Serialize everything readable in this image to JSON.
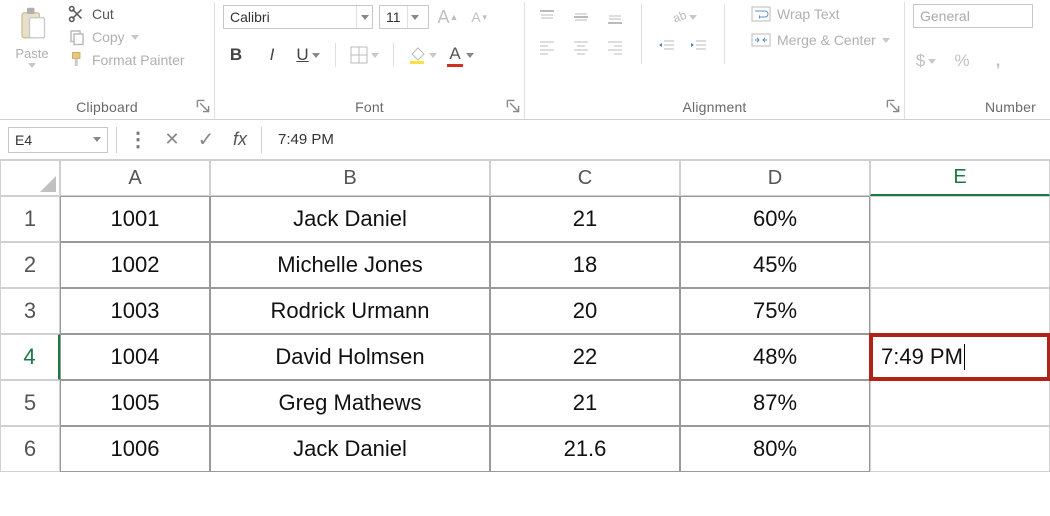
{
  "ribbon": {
    "clipboard": {
      "paste": "Paste",
      "cut": "Cut",
      "copy": "Copy",
      "format_painter": "Format Painter",
      "label": "Clipboard"
    },
    "font": {
      "family": "Calibri",
      "size": "11",
      "bold_glyph": "B",
      "italic_glyph": "I",
      "underline_glyph": "U",
      "increase_a": "A",
      "decrease_a": "A",
      "fontcolor_glyph": "A",
      "label": "Font"
    },
    "alignment": {
      "wrap_text": "Wrap Text",
      "merge_center": "Merge & Center",
      "label": "Alignment"
    },
    "number": {
      "format_value": "General",
      "currency_glyph": "$",
      "percent_glyph": "%",
      "comma_glyph": ",",
      "label": "Number"
    }
  },
  "formula_bar": {
    "name_box": "E4",
    "cancel_glyph": "✕",
    "enter_glyph": "✓",
    "fx_glyph": "fx",
    "value": "7:49 PM"
  },
  "grid": {
    "col_headers": [
      "A",
      "B",
      "C",
      "D",
      "E"
    ],
    "row_headers": [
      "1",
      "2",
      "3",
      "4",
      "5",
      "6"
    ],
    "active_col": "E",
    "active_row": "4",
    "rows": [
      {
        "A": "1001",
        "B": "Jack Daniel",
        "C": "21",
        "D": "60%",
        "E": ""
      },
      {
        "A": "1002",
        "B": "Michelle Jones",
        "C": "18",
        "D": "45%",
        "E": ""
      },
      {
        "A": "1003",
        "B": "Rodrick Urmann",
        "C": "20",
        "D": "75%",
        "E": ""
      },
      {
        "A": "1004",
        "B": "David Holmsen",
        "C": "22",
        "D": "48%",
        "E": "7:49 PM"
      },
      {
        "A": "1005",
        "B": "Greg Mathews",
        "C": "21",
        "D": "87%",
        "E": ""
      },
      {
        "A": "1006",
        "B": "Jack Daniel",
        "C": "21.6",
        "D": "80%",
        "E": ""
      }
    ]
  }
}
